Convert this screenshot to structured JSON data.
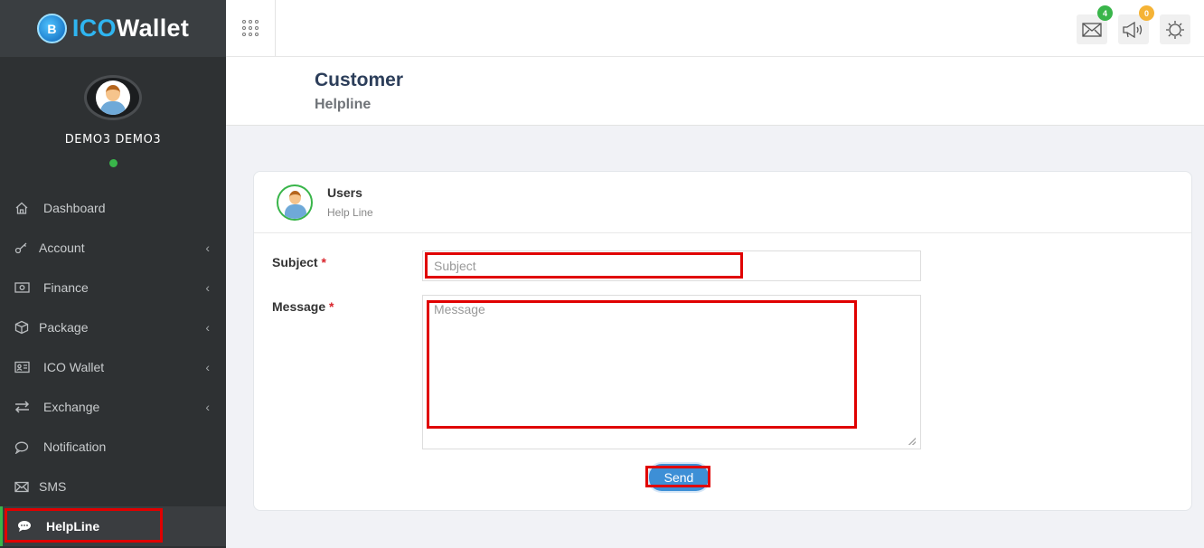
{
  "brand": {
    "prefix": "ICO",
    "suffix": "Wallet",
    "logo_letter": "B"
  },
  "profile": {
    "name": "DEMO3 DEMO3",
    "status": "online"
  },
  "nav": {
    "items": [
      {
        "label": "Dashboard",
        "icon": "home-icon",
        "has_submenu": false
      },
      {
        "label": "Account",
        "icon": "key-icon",
        "has_submenu": true
      },
      {
        "label": "Finance",
        "icon": "money-icon",
        "has_submenu": true
      },
      {
        "label": "Package",
        "icon": "box-icon",
        "has_submenu": true
      },
      {
        "label": "ICO Wallet",
        "icon": "id-card-icon",
        "has_submenu": true
      },
      {
        "label": "Exchange",
        "icon": "exchange-icon",
        "has_submenu": true
      },
      {
        "label": "Notification",
        "icon": "chat-bubble-icon",
        "has_submenu": false
      },
      {
        "label": "SMS",
        "icon": "envelope-icon",
        "has_submenu": false
      },
      {
        "label": "HelpLine",
        "icon": "comment-icon",
        "has_submenu": false,
        "active": true
      }
    ],
    "chevron": "‹"
  },
  "topbar": {
    "mail_badge": "4",
    "announce_badge": "0",
    "mail_badge_color": "#39b54a",
    "announce_badge_color": "#f5b335"
  },
  "page": {
    "title": "Customer",
    "subtitle": "Helpline"
  },
  "card": {
    "title": "Users",
    "subtitle": "Help Line",
    "subject_label": "Subject",
    "message_label": "Message",
    "required_mark": "*",
    "subject_placeholder": "Subject",
    "message_placeholder": "Message",
    "send_label": "Send"
  },
  "colors": {
    "accent": "#3d8fd6",
    "sidebar": "#2e3133",
    "highlight": "#e00000",
    "online": "#39b54a"
  }
}
